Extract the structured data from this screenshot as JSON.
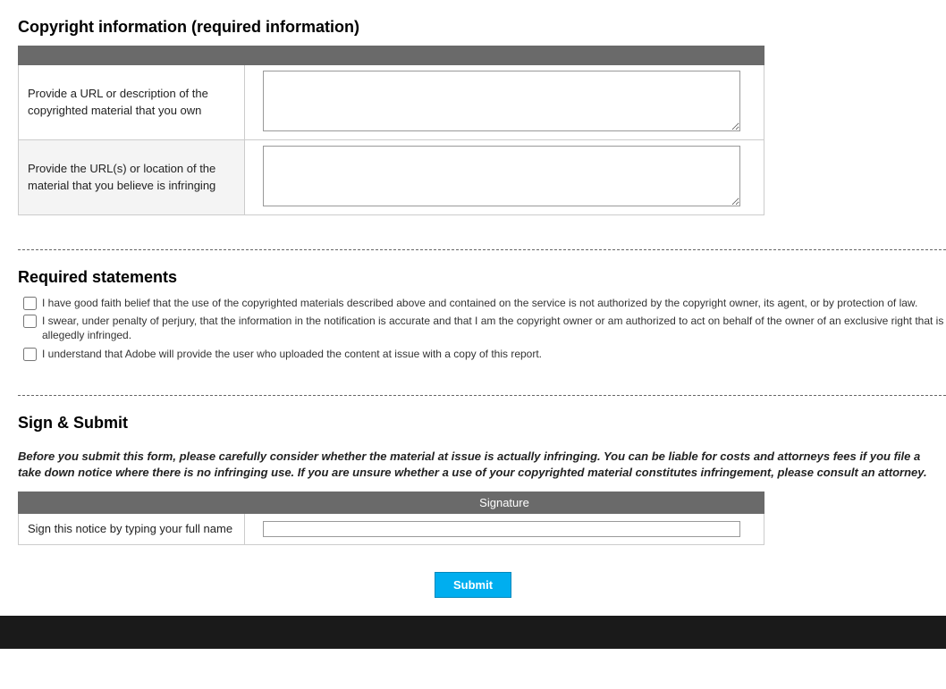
{
  "copyright_section": {
    "heading": "Copyright information (required information)",
    "row1_label": "Provide a URL or description of the copyrighted material that you own",
    "row1_value": "",
    "row2_label": "Provide the URL(s) or location of the material that you believe is infringing",
    "row2_value": ""
  },
  "statements_section": {
    "heading": "Required statements",
    "s1": "I have good faith belief that the use of the copyrighted materials described above and contained on the service is not authorized by the copyright owner, its agent, or by protection of law.",
    "s2": "I swear, under penalty of perjury, that the information in the notification is accurate and that I am the copyright owner or am authorized to act on behalf of the owner of an exclusive right that is allegedly infringed.",
    "s3": "I understand that Adobe will provide the user who uploaded the content at issue with a copy of this report."
  },
  "sign_section": {
    "heading": "Sign & Submit",
    "warning": "Before you submit this form, please carefully consider whether the material at issue is actually infringing. You can be liable for costs and attorneys fees if you file a take down notice where there is no infringing use. If you are unsure whether a use of your copyrighted material constitutes infringement, please consult an attorney.",
    "signature_header": "Signature",
    "signature_label": "Sign this notice by typing your full name",
    "signature_value": ""
  },
  "submit_label": "Submit"
}
